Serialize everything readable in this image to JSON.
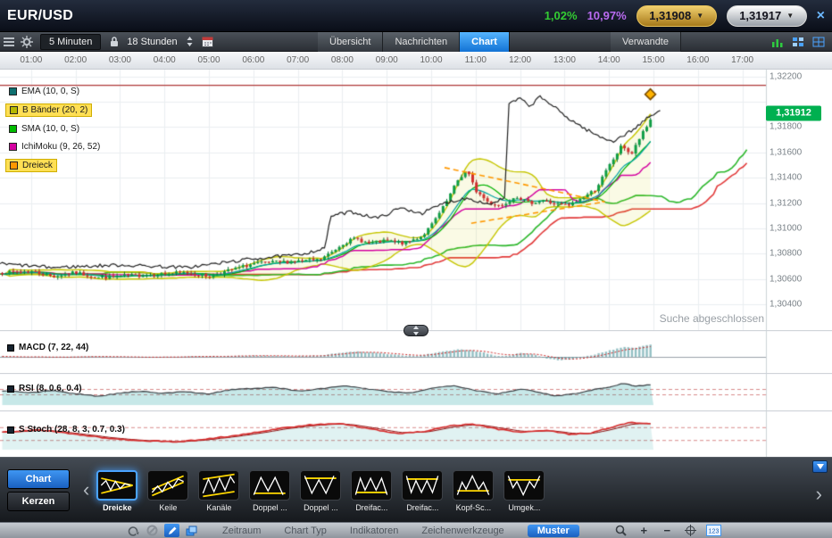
{
  "header": {
    "symbol": "EUR/USD",
    "change_green": "1,02%",
    "change_purple": "10,97%",
    "bid": "1,31908",
    "ask": "1,31917",
    "close_icon": "close-icon",
    "colors": {
      "green": "#33cc33",
      "purple": "#b96bf0",
      "badge_green": "#00b050",
      "active_tab_blue": "#1272d4"
    }
  },
  "toolbar": {
    "interval": "5 Minuten",
    "range": "18 Stunden",
    "icons_left": [
      "list-icon",
      "gear-icon"
    ],
    "lock_icon": "lock-icon",
    "spinner_icon": "spinner-icon",
    "calendar_icon": "calendar-icon",
    "icons_right": [
      "mini-chart-icon",
      "tile-windows-icon",
      "grid-windows-icon"
    ],
    "tabs": [
      {
        "label": "Übersicht",
        "active": false
      },
      {
        "label": "Nachrichten",
        "active": false
      },
      {
        "label": "Chart",
        "active": true
      }
    ],
    "related_tab": {
      "label": "Verwandte",
      "active": false
    }
  },
  "time_axis": [
    "01:00",
    "02:00",
    "03:00",
    "04:00",
    "05:00",
    "06:00",
    "07:00",
    "08:00",
    "09:00",
    "10:00",
    "11:00",
    "12:00",
    "13:00",
    "14:00",
    "15:00",
    "16:00",
    "17:00"
  ],
  "price_axis": {
    "items": [
      {
        "label": "1,32200",
        "value": 1.322
      },
      {
        "label": "1,31800",
        "value": 1.318
      },
      {
        "label": "1,31600",
        "value": 1.316
      },
      {
        "label": "1,31400",
        "value": 1.314
      },
      {
        "label": "1,31200",
        "value": 1.312
      },
      {
        "label": "1,31000",
        "value": 1.31
      },
      {
        "label": "1,30800",
        "value": 1.308
      },
      {
        "label": "1,30600",
        "value": 1.306
      },
      {
        "label": "1,30400",
        "value": 1.304
      }
    ],
    "badge": {
      "label": "1,31912",
      "value": 1.31912,
      "color": "#00b050"
    }
  },
  "legend": [
    {
      "label": "EMA (10, 0, S)",
      "color": "#0e6f6f",
      "highlight": false
    },
    {
      "label": "B Bänder (20, 2)",
      "color": "#b5b800",
      "highlight": true
    },
    {
      "label": "SMA (10, 0, S)",
      "color": "#00bb00",
      "highlight": false
    },
    {
      "label": "IchiMoku (9, 26, 52)",
      "color": "#d400a0",
      "highlight": false
    },
    {
      "label": "Dreieck",
      "color": "#ff9800",
      "highlight": true
    }
  ],
  "status_text": "Suche abgeschlossen",
  "panels": [
    {
      "label": "MACD (7, 22, 44)"
    },
    {
      "label": "RSI (8, 0.6, 0.4)",
      "thresholds": [
        0.6,
        0.4
      ]
    },
    {
      "label": "S Stoch (28, 8, 3, 0.7, 0.3)",
      "thresholds": [
        0.7,
        0.3
      ]
    }
  ],
  "patterns": {
    "chart_button": "Chart",
    "kerzen_button": "Kerzen",
    "scroll_left_icon": "scroll-left-icon",
    "scroll_right_icon": "scroll-right-icon",
    "collapse_icon": "collapse-down-icon",
    "items": [
      {
        "label": "Dreicke",
        "icon": "triangle-pattern-icon",
        "selected": true
      },
      {
        "label": "Keile",
        "icon": "wedge-pattern-icon",
        "selected": false
      },
      {
        "label": "Kanäle",
        "icon": "channel-pattern-icon",
        "selected": false
      },
      {
        "label": "Doppel ...",
        "icon": "double-top-pattern-icon",
        "selected": false
      },
      {
        "label": "Doppel ...",
        "icon": "double-bottom-pattern-icon",
        "selected": false
      },
      {
        "label": "Dreifac...",
        "icon": "triple-top-pattern-icon",
        "selected": false
      },
      {
        "label": "Dreifac...",
        "icon": "triple-bottom-pattern-icon",
        "selected": false
      },
      {
        "label": "Kopf-Sc...",
        "icon": "head-shoulders-pattern-icon",
        "selected": false
      },
      {
        "label": "Umgek...",
        "icon": "inverse-head-shoulders-pattern-icon",
        "selected": false
      }
    ]
  },
  "bottom_bar": {
    "icons_left": [
      {
        "name": "undo-icon",
        "active": false
      },
      {
        "name": "disable-icon",
        "active": false
      },
      {
        "name": "pencil-icon",
        "active": true
      },
      {
        "name": "layers-icon",
        "active": false
      }
    ],
    "menus": [
      {
        "label": "Zeitraum",
        "active": false
      },
      {
        "label": "Chart Typ",
        "active": false
      },
      {
        "label": "Indikatoren",
        "active": false
      },
      {
        "label": "Zeichenwerkzeuge",
        "active": false
      },
      {
        "label": "Muster",
        "active": true
      }
    ],
    "icons_right": [
      {
        "name": "zoom-icon",
        "active": false
      },
      {
        "name": "zoom-in-icon",
        "active": false
      },
      {
        "name": "zoom-out-icon",
        "active": false
      },
      {
        "name": "crosshair-icon",
        "active": false
      },
      {
        "name": "values-icon",
        "active": false
      }
    ],
    "values_icon_label": "123"
  },
  "chart_data": {
    "type": "candlestick",
    "symbol": "EUR/USD",
    "candle_interval_minutes": 5,
    "x_domain_hours": [
      0.3,
      17.53
    ],
    "price_domain": [
      1.30195,
      1.32255
    ],
    "grid_price_step": 0.002,
    "grid_hour_step": 1,
    "resistance_line": 1.3213,
    "current_price": 1.31912,
    "candles_waypoints": [
      [
        0.5,
        1.3065
      ],
      [
        1.0,
        1.3066
      ],
      [
        1.5,
        1.3062
      ],
      [
        2.0,
        1.3065
      ],
      [
        2.5,
        1.3061
      ],
      [
        3.0,
        1.3062
      ],
      [
        3.5,
        1.3063
      ],
      [
        4.0,
        1.3064
      ],
      [
        4.5,
        1.3065
      ],
      [
        5.0,
        1.3062
      ],
      [
        5.5,
        1.3067
      ],
      [
        6.0,
        1.3072
      ],
      [
        6.5,
        1.3073
      ],
      [
        7.0,
        1.3074
      ],
      [
        7.5,
        1.3075
      ],
      [
        7.8,
        1.3082
      ],
      [
        8.0,
        1.3088
      ],
      [
        8.3,
        1.3092
      ],
      [
        8.6,
        1.3088
      ],
      [
        9.0,
        1.309
      ],
      [
        9.4,
        1.3088
      ],
      [
        9.8,
        1.3094
      ],
      [
        10.0,
        1.3102
      ],
      [
        10.3,
        1.3118
      ],
      [
        10.6,
        1.3138
      ],
      [
        10.8,
        1.3146
      ],
      [
        11.0,
        1.313
      ],
      [
        11.3,
        1.312
      ],
      [
        11.6,
        1.3118
      ],
      [
        11.9,
        1.3126
      ],
      [
        12.2,
        1.312
      ],
      [
        12.5,
        1.3122
      ],
      [
        12.8,
        1.3119
      ],
      [
        13.1,
        1.3118
      ],
      [
        13.4,
        1.3124
      ],
      [
        13.7,
        1.3131
      ],
      [
        14.0,
        1.3149
      ],
      [
        14.3,
        1.3166
      ],
      [
        14.5,
        1.3158
      ],
      [
        14.7,
        1.3172
      ],
      [
        14.85,
        1.318
      ],
      [
        15.0,
        1.3191
      ]
    ],
    "black_line_waypoints": [
      [
        0.3,
        1.3072
      ],
      [
        1.5,
        1.3069
      ],
      [
        3.0,
        1.3071
      ],
      [
        4.5,
        1.3069
      ],
      [
        6.0,
        1.3076
      ],
      [
        7.0,
        1.3079
      ],
      [
        7.6,
        1.3084
      ],
      [
        7.75,
        1.311
      ],
      [
        8.2,
        1.3113
      ],
      [
        8.8,
        1.3108
      ],
      [
        9.3,
        1.3116
      ],
      [
        9.8,
        1.3112
      ],
      [
        10.3,
        1.312
      ],
      [
        10.8,
        1.3124
      ],
      [
        11.3,
        1.3119
      ],
      [
        11.65,
        1.3124
      ],
      [
        11.75,
        1.3198
      ],
      [
        12.0,
        1.3203
      ],
      [
        12.2,
        1.3196
      ],
      [
        12.45,
        1.3204
      ],
      [
        12.7,
        1.3198
      ],
      [
        13.0,
        1.3189
      ],
      [
        13.4,
        1.318
      ],
      [
        13.8,
        1.3172
      ],
      [
        14.1,
        1.3169
      ],
      [
        14.5,
        1.3177
      ],
      [
        14.9,
        1.3188
      ],
      [
        15.2,
        1.3194
      ]
    ],
    "triangle_pattern": {
      "upper": [
        [
          10.3,
          1.3148
        ],
        [
          13.9,
          1.3121
        ]
      ],
      "lower": [
        [
          10.9,
          1.3104
        ],
        [
          13.9,
          1.3121
        ]
      ]
    },
    "marker": {
      "t": 14.93,
      "price": 1.3206
    },
    "macd_waypoints": [
      [
        0.5,
        0.02
      ],
      [
        1.5,
        -0.03
      ],
      [
        2.5,
        0.03
      ],
      [
        3.5,
        -0.04
      ],
      [
        4.5,
        0.02
      ],
      [
        5.5,
        0.05
      ],
      [
        6.0,
        0.1
      ],
      [
        6.5,
        0.08
      ],
      [
        7.0,
        0.06
      ],
      [
        7.5,
        0.1
      ],
      [
        8.0,
        0.32
      ],
      [
        8.3,
        0.4
      ],
      [
        8.6,
        0.34
      ],
      [
        9.0,
        0.22
      ],
      [
        9.4,
        0.1
      ],
      [
        9.7,
        0.08
      ],
      [
        10.0,
        0.24
      ],
      [
        10.3,
        0.42
      ],
      [
        10.6,
        0.55
      ],
      [
        10.9,
        0.5
      ],
      [
        11.2,
        0.3
      ],
      [
        11.5,
        0.05
      ],
      [
        11.8,
        0.12
      ],
      [
        12.0,
        0.3
      ],
      [
        12.3,
        0.18
      ],
      [
        12.6,
        -0.12
      ],
      [
        12.9,
        -0.26
      ],
      [
        13.2,
        -0.18
      ],
      [
        13.5,
        0.05
      ],
      [
        13.8,
        0.28
      ],
      [
        14.1,
        0.55
      ],
      [
        14.4,
        0.75
      ],
      [
        14.6,
        0.68
      ],
      [
        14.8,
        0.85
      ],
      [
        15.0,
        0.95
      ]
    ],
    "rsi_waypoints": [
      [
        0.5,
        0.52
      ],
      [
        1.0,
        0.46
      ],
      [
        1.5,
        0.55
      ],
      [
        2.0,
        0.42
      ],
      [
        2.5,
        0.33
      ],
      [
        3.0,
        0.45
      ],
      [
        3.5,
        0.52
      ],
      [
        4.0,
        0.44
      ],
      [
        4.5,
        0.5
      ],
      [
        5.0,
        0.42
      ],
      [
        5.5,
        0.58
      ],
      [
        6.0,
        0.62
      ],
      [
        6.5,
        0.66
      ],
      [
        7.0,
        0.52
      ],
      [
        7.5,
        0.6
      ],
      [
        8.0,
        0.72
      ],
      [
        8.5,
        0.62
      ],
      [
        9.0,
        0.5
      ],
      [
        9.5,
        0.45
      ],
      [
        10.0,
        0.62
      ],
      [
        10.5,
        0.74
      ],
      [
        11.0,
        0.55
      ],
      [
        11.5,
        0.42
      ],
      [
        12.0,
        0.6
      ],
      [
        12.5,
        0.45
      ],
      [
        12.8,
        0.34
      ],
      [
        13.2,
        0.42
      ],
      [
        13.6,
        0.56
      ],
      [
        14.0,
        0.68
      ],
      [
        14.3,
        0.8
      ],
      [
        14.6,
        0.72
      ],
      [
        15.0,
        0.76
      ]
    ],
    "stoch_waypoints": [
      [
        0.5,
        0.55
      ],
      [
        1.2,
        0.62
      ],
      [
        2.0,
        0.48
      ],
      [
        2.8,
        0.34
      ],
      [
        3.5,
        0.28
      ],
      [
        4.3,
        0.24
      ],
      [
        5.0,
        0.34
      ],
      [
        5.8,
        0.48
      ],
      [
        6.5,
        0.64
      ],
      [
        7.2,
        0.76
      ],
      [
        7.9,
        0.82
      ],
      [
        8.5,
        0.68
      ],
      [
        9.2,
        0.5
      ],
      [
        9.8,
        0.56
      ],
      [
        10.4,
        0.74
      ],
      [
        10.9,
        0.8
      ],
      [
        11.5,
        0.64
      ],
      [
        12.0,
        0.55
      ],
      [
        12.6,
        0.6
      ],
      [
        13.1,
        0.48
      ],
      [
        13.6,
        0.52
      ],
      [
        14.0,
        0.68
      ],
      [
        14.5,
        0.85
      ],
      [
        15.0,
        0.8
      ]
    ],
    "colors": {
      "up": "#0f9d45",
      "down": "#d22f2f",
      "black_line": "#222222",
      "ema": "#00a3a3",
      "sma": "#00b300",
      "bollinger": "#c6c600",
      "kijun": "#d400a0",
      "senkou_a": "#2db82d",
      "senkou_b": "#e23b3b",
      "triangle": "#ff9800",
      "resistance": "#b03a3a",
      "macd_bar": "#3a8c94",
      "macd_signal": "#cc2222",
      "rsi_line": "#3a3f44",
      "stoch_k": "#d62b2b",
      "stoch_d": "#8c1212"
    }
  }
}
